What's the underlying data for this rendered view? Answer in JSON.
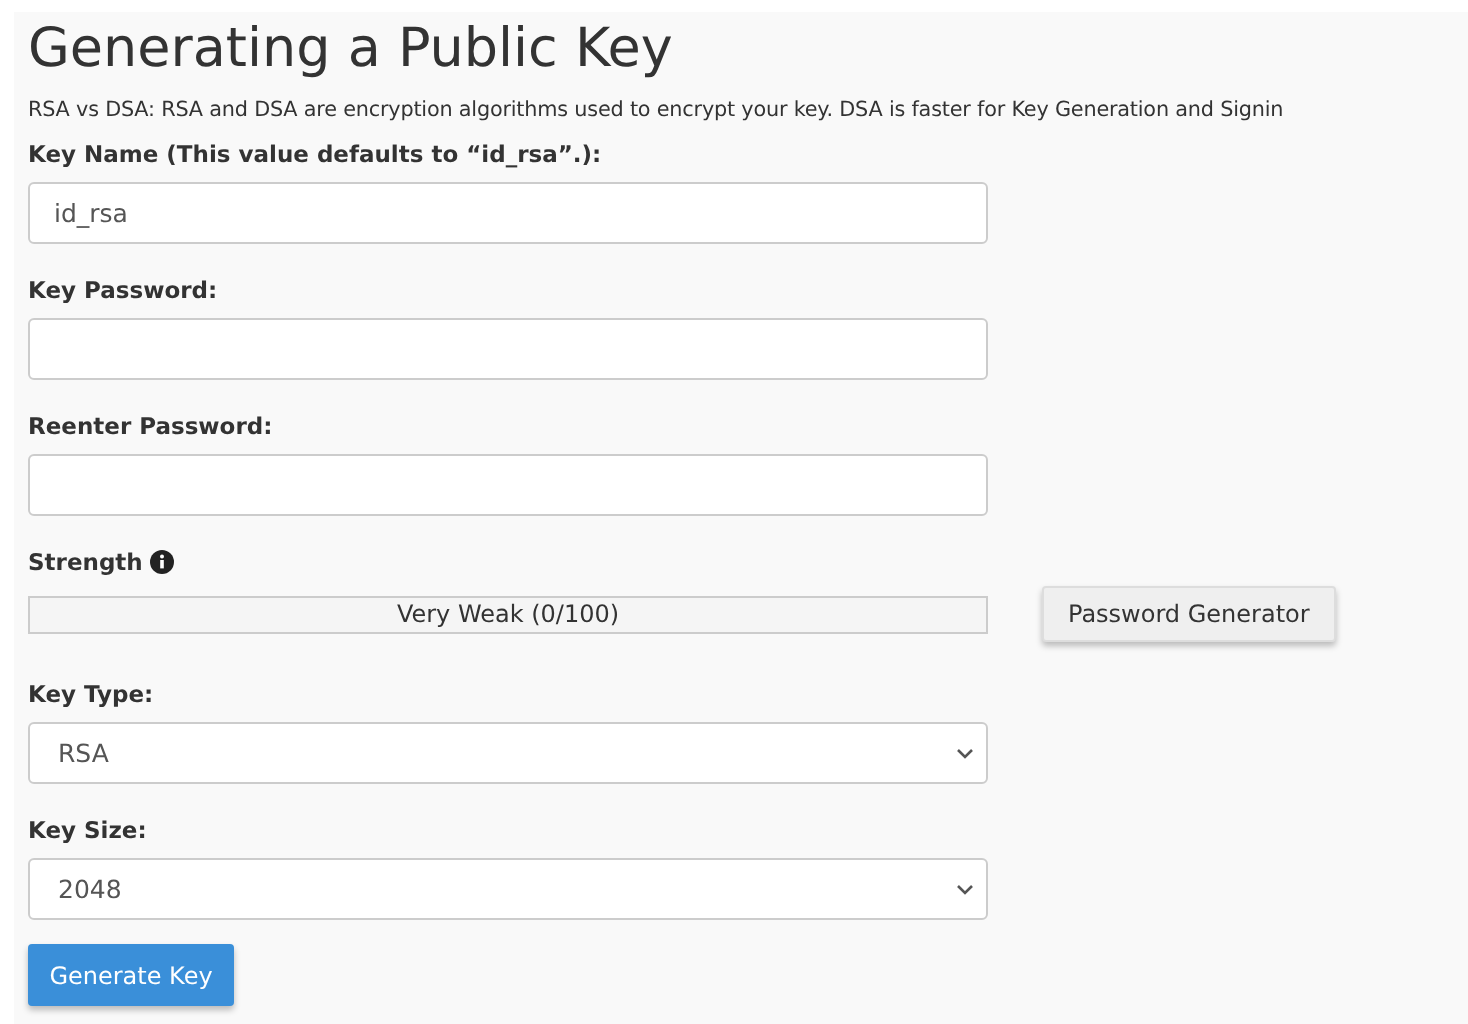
{
  "heading": "Generating a Public Key",
  "description": "RSA vs DSA: RSA and DSA are encryption algorithms used to encrypt your key. DSA is faster for Key Generation and Signin",
  "fields": [
    {
      "label": "Key Name (This value defaults to “id_rsa”.):",
      "value": "id_rsa"
    },
    {
      "label": "Key Password:"
    },
    {
      "label": "Reenter Password:"
    }
  ],
  "strength": {
    "label": "Strength",
    "level": 0,
    "reading": "Very Weak (0/100)",
    "generator_button": "Password Generator"
  },
  "selects": [
    {
      "label": "Key Type:",
      "value": "RSA"
    },
    {
      "label": "Key Size:",
      "value": "2048"
    }
  ],
  "submit_button": "Generate Key"
}
